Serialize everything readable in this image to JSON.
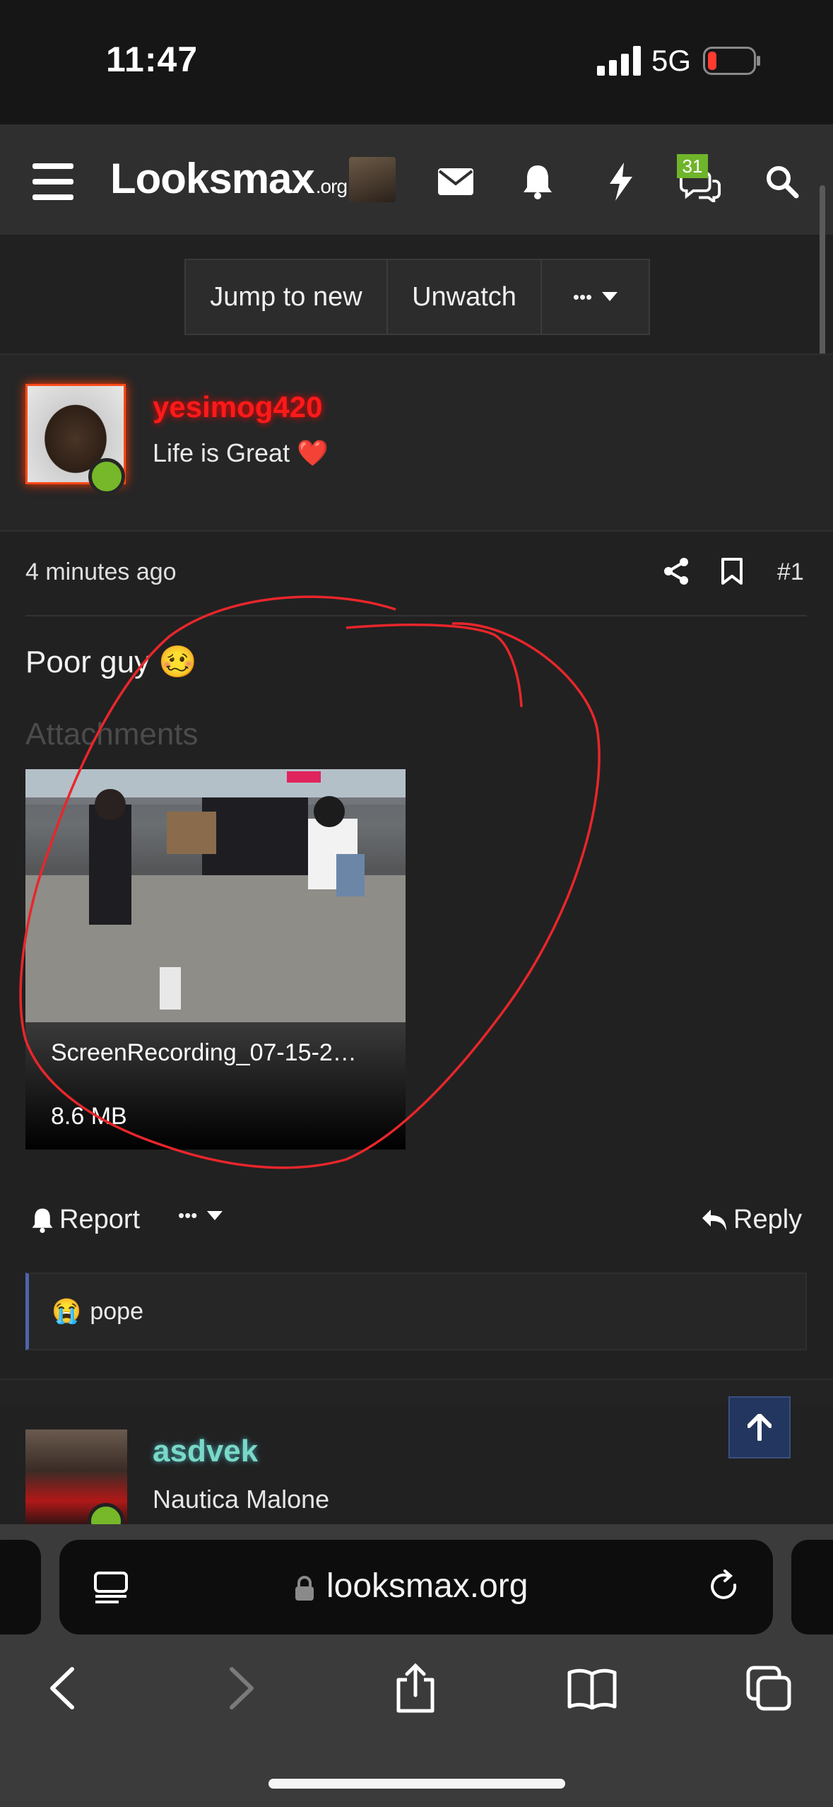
{
  "status_bar": {
    "time": "11:47",
    "network": "5G"
  },
  "nav": {
    "logo_main": "Looksmax",
    "logo_suffix": ".org",
    "badge_count": "31",
    "icons": [
      "menu-icon",
      "mail-icon",
      "bell-icon",
      "bolt-icon",
      "chat-icon",
      "search-icon"
    ]
  },
  "thread_controls": {
    "jump": "Jump to new",
    "unwatch": "Unwatch",
    "more": "•••"
  },
  "post": {
    "username": "yesimog420",
    "user_title": "Life is Great ❤️",
    "time": "4 minutes ago",
    "number": "#1",
    "text": "Poor guy 🥴",
    "attachments_heading": "Attachments",
    "attachment": {
      "name": "ScreenRecording_07-15-2…",
      "size": "8.6 MB"
    },
    "actions": {
      "report": "Report",
      "more": "•••",
      "reply": "Reply"
    },
    "reaction": {
      "emoji": "😭",
      "user": "pope"
    }
  },
  "next_post": {
    "username": "asdvek",
    "user_title": "Nautica Malone"
  },
  "browser": {
    "url": "looksmax.org"
  },
  "colors": {
    "accent_red": "#ff1a1a",
    "online": "#76b82a",
    "username2": "#7ad9c5",
    "annotation": "#e8262b"
  }
}
